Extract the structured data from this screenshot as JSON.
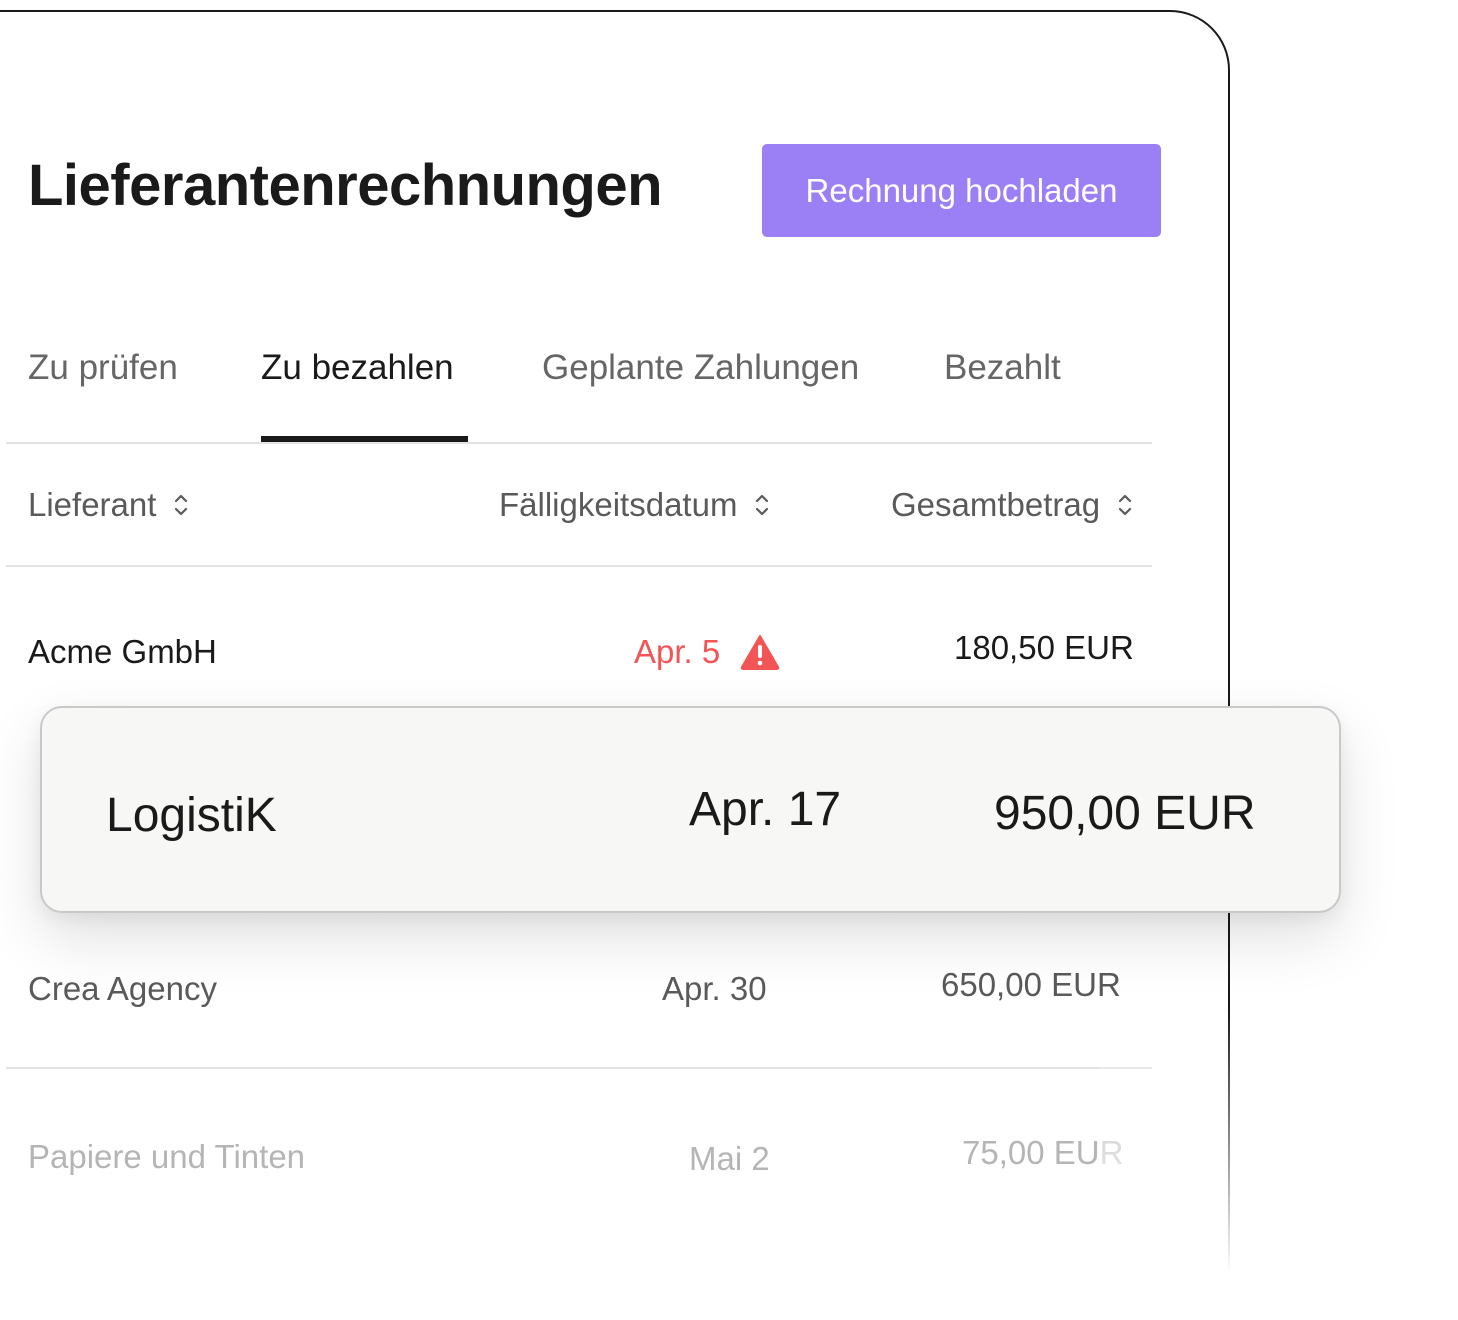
{
  "header": {
    "title": "Lieferantenrechnungen",
    "upload_button": "Rechnung hochladen"
  },
  "tabs": [
    {
      "label": "Zu prüfen",
      "active": false
    },
    {
      "label": "Zu bezahlen",
      "active": true
    },
    {
      "label": "Geplante Zahlungen",
      "active": false
    },
    {
      "label": "Bezahlt",
      "active": false
    }
  ],
  "table": {
    "columns": [
      "Lieferant",
      "Fälligkeitsdatum",
      "Gesamtbetrag"
    ],
    "rows": [
      {
        "supplier": "Acme GmbH",
        "due": "Apr. 5",
        "amount": "180,50 EUR",
        "overdue": true
      },
      {
        "supplier": "LogistiK",
        "due": "Apr. 17",
        "amount": "950,00 EUR",
        "highlighted": true
      },
      {
        "supplier": "Crea Agency",
        "due": "Apr. 30",
        "amount": "650,00 EUR"
      },
      {
        "supplier": "Papiere und Tinten",
        "due": "Mai 2",
        "amount": "75,00 EUR"
      }
    ]
  },
  "colors": {
    "accent": "#9b80f5",
    "overdue": "#f25555",
    "text": "#1a1a1a",
    "muted": "#5a5a5a",
    "faded": "#b5b5b5"
  },
  "icons": {
    "sort": "sort-icon",
    "warning": "warning-icon"
  }
}
